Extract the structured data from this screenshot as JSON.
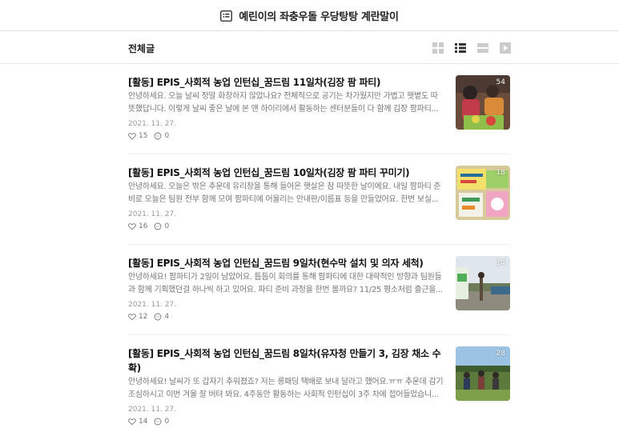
{
  "header": {
    "title": "예린이의 좌충우돌 우당탕탕 계란말이"
  },
  "subheader": {
    "label": "전체글"
  },
  "posts": [
    {
      "title": "[활동] EPIS_사회적 농업 인턴십_꿈드림 11일차(김장 팜 파티)",
      "excerpt": "안녕하세요. 오늘 날씨 정말 화창하지 않았나요? 전체적으로 공기는 차가웠지만 가볍고 햇볕도 따뜻했답니다. 이렇게 날씨 좋은 날에 본 앤 하이리에서 활동하는 센터분들이 다 함께 김장 팜파티...",
      "date": "2021. 11. 27.",
      "likes": "15",
      "comments": "0",
      "photo_count": "54"
    },
    {
      "title": "[활동] EPIS_사회적 농업 인턴십_꿈드림 10일차(김장 팜 파티 꾸미기)",
      "excerpt": "안녕하세요. 오늘은 밖은 추운데 유리창을 통해 들어온 햇살은 참 따뜻한 날이에요. 내일 팜파티 준비로 오늘은 팀원 전부 함께 모여 팜파티에 어울리는 안내판/이름표 등을 만들었어요. 한번 보실...",
      "date": "2021. 11. 27.",
      "likes": "16",
      "comments": "0",
      "photo_count": "18"
    },
    {
      "title": "[활동] EPIS_사회적 농업 인턴십_꿈드림 9일차(현수막 설치 및 의자 세척)",
      "excerpt": "안녕하세요! 팜파티가 2일이 남았어요. 틈틈이 회의를 통해 팜파티에 대한 대략적인 방향과 팀원들과 함께 기획했던걸 하나씩 하고 있어요. 파티 준비 과정을 한번 볼까요? 11/25 평소처럼 출근을...",
      "date": "2021. 11. 27.",
      "likes": "12",
      "comments": "4",
      "photo_count": "14"
    },
    {
      "title": "[활동] EPIS_사회적 농업 인턴십_꿈드림 8일차(유자청 만들기 3, 김장 채소 수확)",
      "excerpt": "안녕하세요! 날씨가 또 갑자기 추워졌죠? 저는 롱패딩 택배로 보내 달라고 했어요.ㅠㅠ 추운데 감기 조심하시고 이번 겨울 잘 버텨 봐요. 4주동안 활동하는 사회적 인턴십이 3주 차에 접어들었습니...",
      "date": "2021. 11. 27.",
      "likes": "14",
      "comments": "0",
      "photo_count": "28"
    }
  ],
  "icons": {
    "blog": "blog-list-icon",
    "view_album": "grid-view-icon",
    "view_list": "list-view-icon",
    "view_card": "card-view-icon",
    "view_video": "video-view-icon",
    "like": "heart-icon",
    "comment": "comment-icon"
  },
  "colors": {
    "text": "#222222",
    "muted": "#777777",
    "border": "#e2e2e2",
    "toggle_active": "#333333",
    "toggle_inactive": "#cccccc"
  }
}
